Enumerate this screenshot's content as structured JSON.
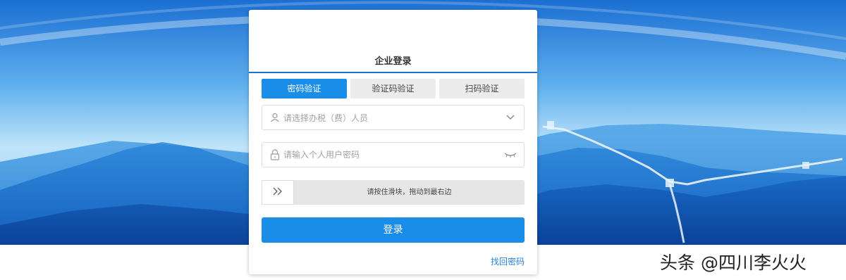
{
  "card": {
    "title": "企业登录",
    "tabs": [
      {
        "label": "密码验证",
        "active": true
      },
      {
        "label": "验证码验证",
        "active": false
      },
      {
        "label": "扫码验证",
        "active": false
      }
    ],
    "taxpayer_select": {
      "placeholder": "请选择办税（费）人员",
      "icon": "user-icon",
      "right_icon": "chevron-down-icon"
    },
    "password_field": {
      "placeholder": "请输入个人用户密码",
      "icon": "lock-icon",
      "right_icon": "eye-closed-icon"
    },
    "slider": {
      "text": "请按住滑块，拖动到最右边",
      "handle_icon": "double-chevron-right-icon"
    },
    "login_label": "登录",
    "forgot_label": "找回密码"
  },
  "watermark": "头条 @四川李火火",
  "colors": {
    "accent": "#1a8de8",
    "title_line": "#1e6fd0",
    "link": "#2a7fd8"
  }
}
